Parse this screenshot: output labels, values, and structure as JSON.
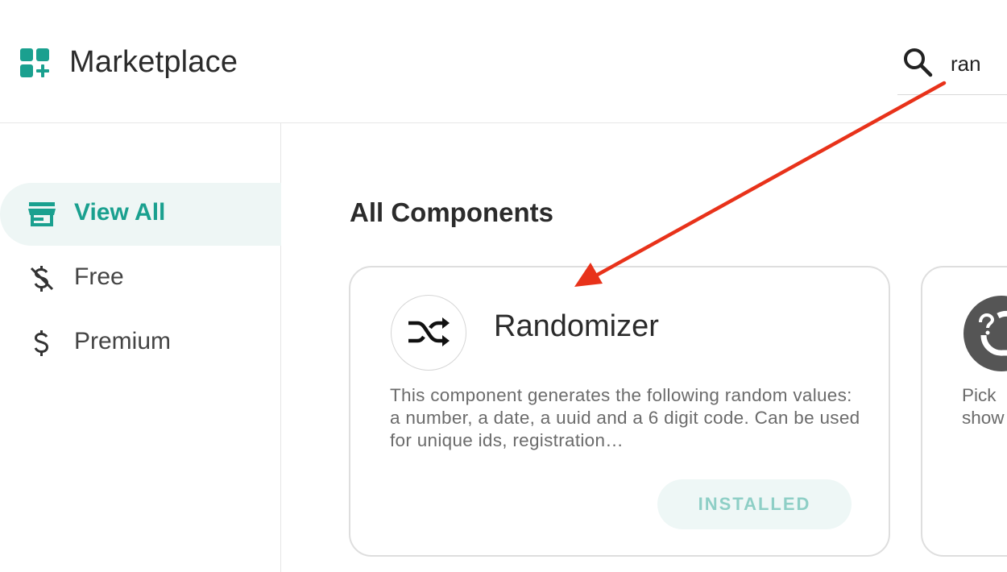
{
  "header": {
    "app_title": "Marketplace",
    "logo_icon": "marketplace-grid-plus-icon",
    "search": {
      "icon": "search-icon",
      "value": "ran"
    }
  },
  "sidebar": {
    "items": [
      {
        "label": "View All",
        "icon": "storefront-icon",
        "active": true
      },
      {
        "label": "Free",
        "icon": "no-dollar-icon",
        "active": false
      },
      {
        "label": "Premium",
        "icon": "dollar-icon",
        "active": false
      }
    ]
  },
  "main": {
    "section_title": "All Components",
    "cards": [
      {
        "title": "Randomizer",
        "icon": "shuffle-icon",
        "description": "This component generates the following random values: a number, a date, a uuid and a 6 digit code. Can be used for unique ids, registration…",
        "status_button": "INSTALLED"
      },
      {
        "icon": "question-refresh-icon",
        "description_lines": [
          "Pick",
          "show"
        ]
      }
    ]
  },
  "annotation": {
    "arrow_color": "#e8321a"
  },
  "colors": {
    "accent": "#1aa08f",
    "active_bg": "#eef6f5",
    "installed_text": "#8ecfc6"
  }
}
